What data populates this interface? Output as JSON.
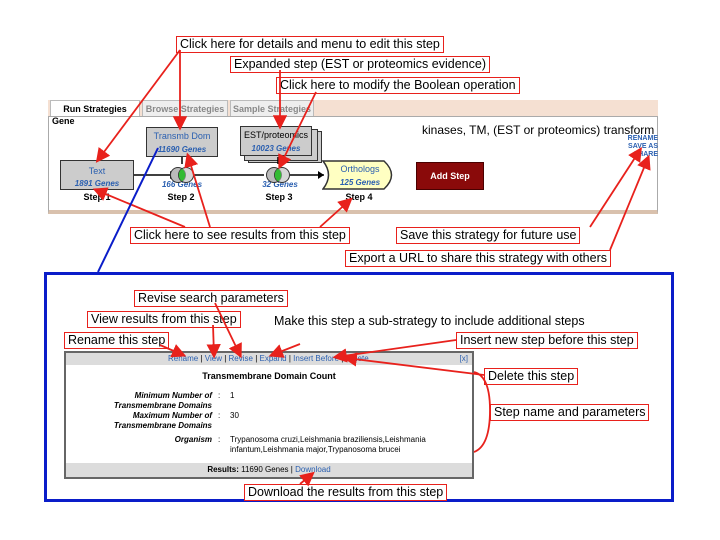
{
  "tabs": {
    "run": "Run Strategies",
    "browse": "Browse Strategies",
    "sample": "Sample Strategies"
  },
  "strategy": {
    "record_type": "Gene",
    "name": "kinases, TM, (EST or proteomics) transform",
    "rename": "RENAME",
    "save_as": "SAVE AS",
    "share": "SHARE",
    "add_step": "Add Step",
    "steps": [
      {
        "name": "Text",
        "genes": "1891 Genes",
        "label": "Step 1"
      },
      {
        "name": "Transmb Dom",
        "genes": "11690 Genes",
        "boolean_genes": "166 Genes",
        "label": "Step 2"
      },
      {
        "name": "EST/proteomics",
        "genes": "10023 Genes",
        "boolean_genes": "32 Genes",
        "label": "Step 3"
      },
      {
        "name": "Orthologs",
        "genes": "125 Genes",
        "label": "Step 4"
      }
    ]
  },
  "popup": {
    "links": {
      "rename": "Rename",
      "view": "View",
      "revise": "Revise",
      "expand": "Expand",
      "insert_before": "Insert Before",
      "delete": "Delete",
      "close": "[x]"
    },
    "title": "Transmembrane Domain Count",
    "params": [
      {
        "label": "Minimum Number of Transmembrane Domains",
        "value": "1"
      },
      {
        "label": "Maximum Number of Transmembrane Domains",
        "value": "30"
      },
      {
        "label": "Organism",
        "value": "Trypanosoma cruzi,Leishmania braziliensis,Leishmania infantum,Leishmania major,Trypanosoma brucei"
      }
    ],
    "results_label": "Results:",
    "results_value": "11690 Genes",
    "download": "Download"
  },
  "callouts": {
    "details_menu": "Click here for details and menu to edit this step",
    "expanded_step": "Expanded step (EST or proteomics evidence)",
    "modify_boolean": "Click here to modify the Boolean operation",
    "see_results": "Click here to see results from this step",
    "save_strategy": "Save this strategy for future use",
    "export_url": "Export a URL to share this strategy with others",
    "revise_params": "Revise search parameters",
    "view_results": "View results from this step",
    "rename_step": "Rename this step",
    "make_substrategy": "Make this step a sub-strategy to include additional steps",
    "insert_before": "Insert new step before this step",
    "delete_step": "Delete this step",
    "step_name_params": "Step name and parameters",
    "download_results": "Download the results from this step"
  },
  "colors": {
    "annotation": "#e8211c",
    "outer_frame": "#0a1dc9",
    "add_step_bg": "#8a0a0a",
    "link_blue": "#2a5fb0",
    "orthologs_bg": "#ffffc2"
  }
}
